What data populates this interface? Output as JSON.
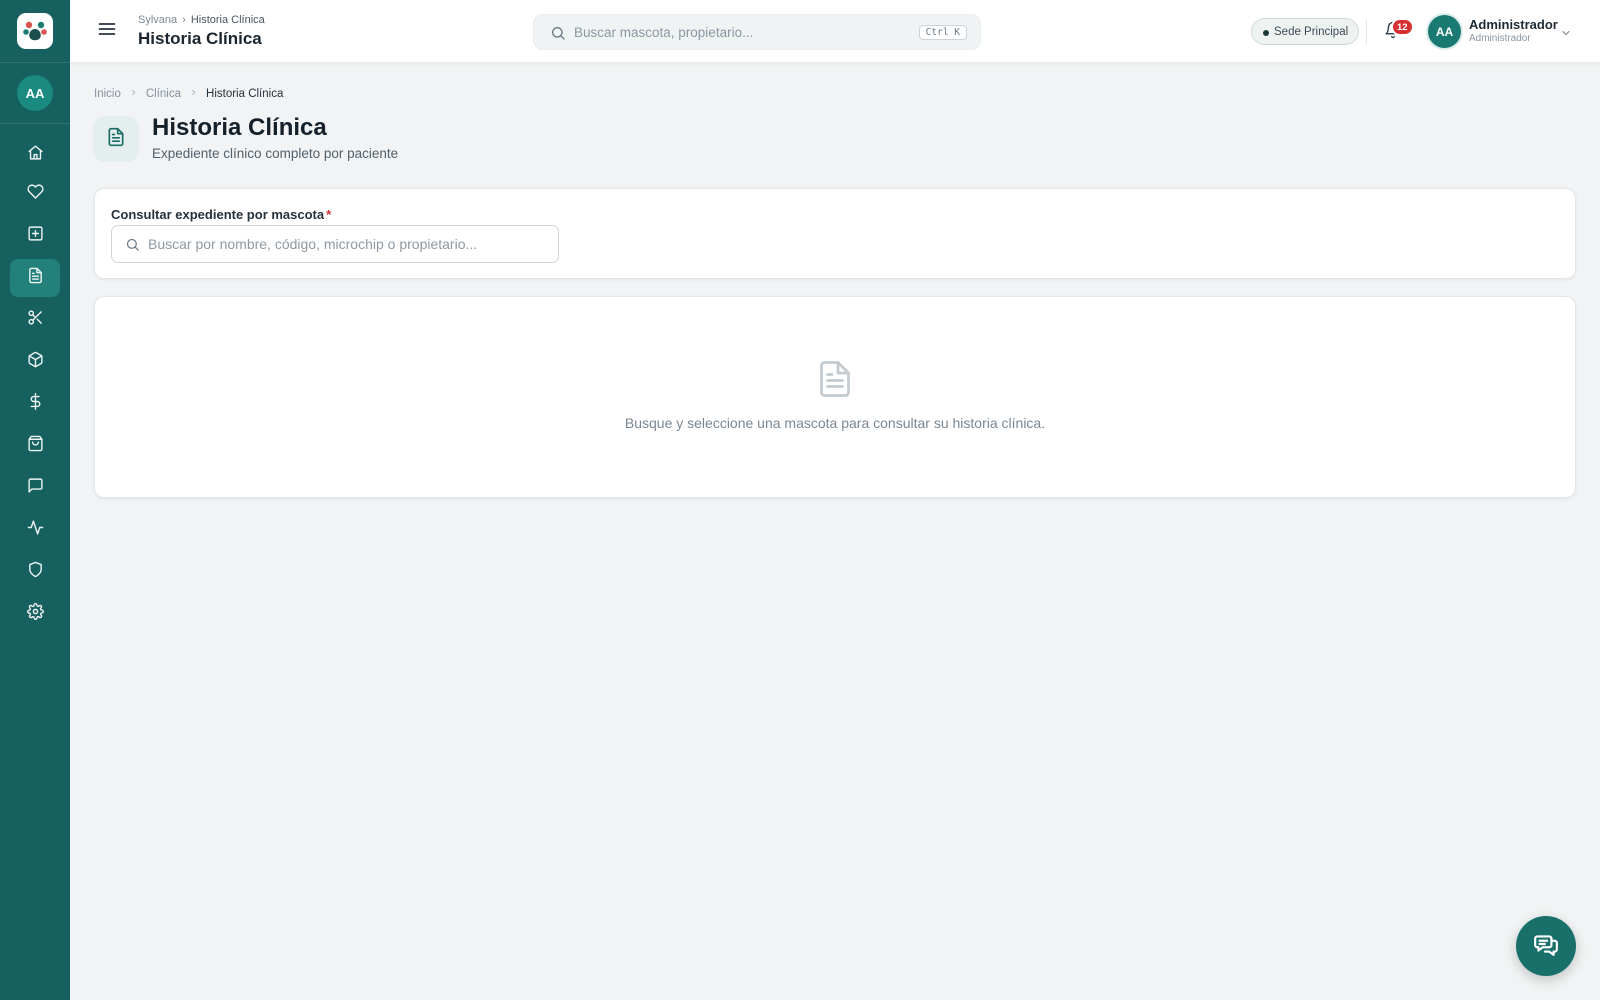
{
  "sidebar": {
    "avatar_initials": "AA",
    "active_item": "historia-clinica",
    "items": [
      {
        "id": "home",
        "icon": "home-icon"
      },
      {
        "id": "favorites",
        "icon": "heart-icon"
      },
      {
        "id": "add",
        "icon": "plus-square-icon"
      },
      {
        "id": "historia-clinica",
        "icon": "file-text-icon"
      },
      {
        "id": "grooming",
        "icon": "scissors-icon"
      },
      {
        "id": "inventory",
        "icon": "package-icon"
      },
      {
        "id": "billing",
        "icon": "dollar-icon"
      },
      {
        "id": "store",
        "icon": "shopping-bag-icon"
      },
      {
        "id": "messages",
        "icon": "message-icon"
      },
      {
        "id": "activity",
        "icon": "activity-icon"
      },
      {
        "id": "security",
        "icon": "shield-icon"
      },
      {
        "id": "settings",
        "icon": "gear-icon"
      }
    ]
  },
  "header": {
    "breadcrumb": {
      "root": "Sylvana",
      "current": "Historia Clínica"
    },
    "title": "Historia Clínica",
    "search": {
      "placeholder": "Buscar mascota, propietario...",
      "shortcut": "Ctrl K"
    },
    "branch": "Sede Principal",
    "notifications_count": "12",
    "user": {
      "initials": "AA",
      "name": "Administrador",
      "role": "Administrador"
    }
  },
  "main": {
    "breadcrumb": {
      "home": "Inicio",
      "section": "Clínica",
      "current": "Historia Clínica"
    },
    "title": "Historia Clínica",
    "subtitle": "Expediente clínico completo por paciente",
    "search_card": {
      "label": "Consultar expediente por mascota",
      "required_mark": "*",
      "placeholder": "Buscar por nombre, código, microchip o propietario..."
    },
    "empty_state": {
      "icon": "document-icon",
      "message": "Busque y seleccione una mascota para consultar su historia clínica."
    }
  },
  "colors": {
    "sidebar": "#16605f",
    "accent": "#1a7a72",
    "danger": "#d63031"
  }
}
